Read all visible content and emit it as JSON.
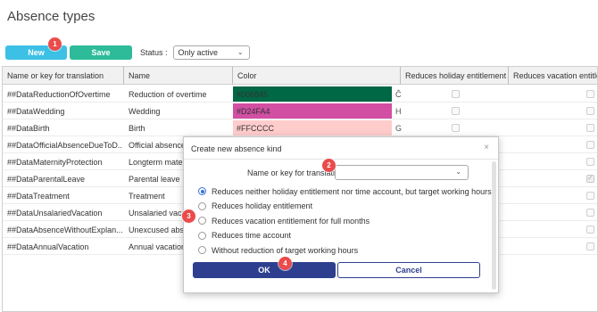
{
  "page_title": "Absence types",
  "toolbar": {
    "new_label": "New",
    "save_label": "Save",
    "status_label": "Status :",
    "status_value": "Only active"
  },
  "badges": [
    "1",
    "2",
    "3",
    "4"
  ],
  "grid": {
    "headers": [
      "Name or key for translation",
      "Name",
      "Color",
      "Reduces holiday entitlement",
      "Reduces vacation entitle"
    ],
    "rows": [
      {
        "key": "##DataReductionOfOvertime",
        "name": "Reduction of overtime",
        "color_text": "#006845",
        "color": "#006845",
        "glyph": "Ĉ",
        "holiday": false,
        "vacation": false
      },
      {
        "key": "##DataWedding",
        "name": "Wedding",
        "color_text": "#D24FA4",
        "color": "#D24FA4",
        "glyph": "H",
        "holiday": false,
        "vacation": false
      },
      {
        "key": "##DataBirth",
        "name": "Birth",
        "color_text": "#FFCCCC",
        "color": "#FFCCCC",
        "glyph": "G",
        "holiday": false,
        "vacation": false
      },
      {
        "key": "##DataOfficialAbsenceDueToD...",
        "name": "Official absence",
        "color_text": "",
        "color": "",
        "glyph": "",
        "holiday": false,
        "vacation": false
      },
      {
        "key": "##DataMaternityProtection",
        "name": "Longterm mater",
        "color_text": "",
        "color": "",
        "glyph": "",
        "holiday": false,
        "vacation": false
      },
      {
        "key": "##DataParentalLeave",
        "name": "Parental leave",
        "color_text": "",
        "color": "",
        "glyph": "",
        "holiday": false,
        "vacation": true
      },
      {
        "key": "##DataTreatment",
        "name": "Treatment",
        "color_text": "",
        "color": "",
        "glyph": "",
        "holiday": false,
        "vacation": false
      },
      {
        "key": "##DataUnsalariedVacation",
        "name": "Unsalaried vaca",
        "color_text": "",
        "color": "",
        "glyph": "",
        "holiday": false,
        "vacation": false
      },
      {
        "key": "##DataAbsenceWithoutExplan...",
        "name": "Unexcused abs",
        "color_text": "",
        "color": "",
        "glyph": "",
        "holiday": false,
        "vacation": false
      },
      {
        "key": "##DataAnnualVacation",
        "name": "Annual vacation",
        "color_text": "",
        "color": "",
        "glyph": "",
        "holiday": false,
        "vacation": false
      }
    ]
  },
  "modal": {
    "title": "Create new absence kind",
    "close": "×",
    "field_label": "Name or key for translation :",
    "field_value": "",
    "options": [
      "Reduces neither holiday entitlement nor time account, but target working hours",
      "Reduces holiday entitlement",
      "Reduces vacation entitlement for full months",
      "Reduces time account",
      "Without reduction of target working hours"
    ],
    "selected_option": 0,
    "ok_label": "OK",
    "cancel_label": "Cancel"
  }
}
